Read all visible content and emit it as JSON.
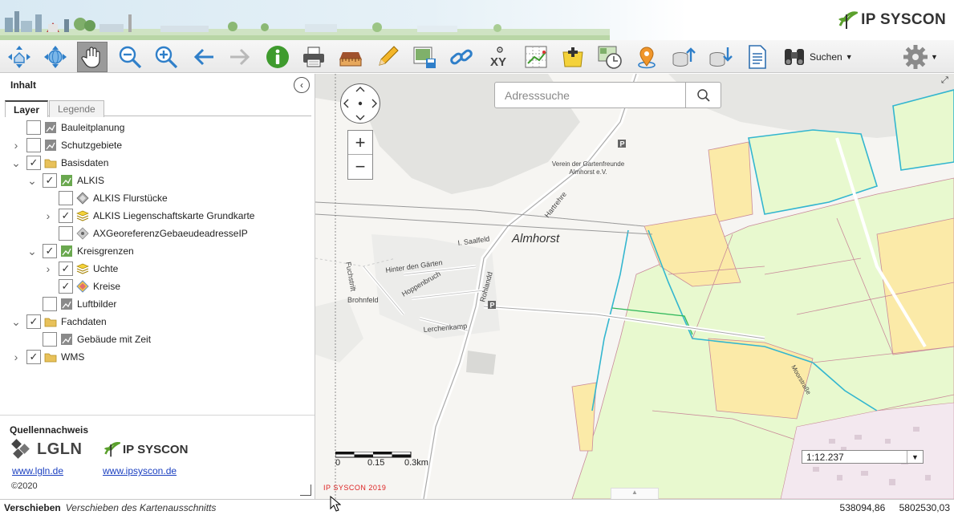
{
  "brand": {
    "name": "IP SYSCON"
  },
  "toolbar": {
    "tools": [
      {
        "name": "home-extent",
        "icon": "home-arrows-icon",
        "active": false
      },
      {
        "name": "globe-extent",
        "icon": "globe-icon",
        "active": false
      },
      {
        "name": "pan",
        "icon": "hand-icon",
        "active": true
      },
      {
        "name": "zoom-out",
        "icon": "zoom-out-icon",
        "active": false
      },
      {
        "name": "zoom-in",
        "icon": "zoom-in-icon",
        "active": false
      },
      {
        "name": "back",
        "icon": "arrow-left-icon",
        "active": false
      },
      {
        "name": "forward",
        "icon": "arrow-right-icon",
        "active": false
      },
      {
        "name": "info",
        "icon": "info-icon",
        "active": false
      },
      {
        "name": "print",
        "icon": "printer-icon",
        "active": false
      },
      {
        "name": "measure",
        "icon": "ruler-icon",
        "active": false
      },
      {
        "name": "draw",
        "icon": "pencil-icon",
        "active": false
      },
      {
        "name": "save-map",
        "icon": "save-image-icon",
        "active": false
      },
      {
        "name": "link",
        "icon": "link-icon",
        "active": false
      },
      {
        "name": "xy",
        "icon": "xy-icon",
        "active": false
      },
      {
        "name": "grid",
        "icon": "grid-icon",
        "active": false
      },
      {
        "name": "add-note",
        "icon": "sign-plus-icon",
        "active": false
      },
      {
        "name": "timeline",
        "icon": "clock-map-icon",
        "active": false
      },
      {
        "name": "location",
        "icon": "map-pin-icon",
        "active": false
      },
      {
        "name": "upload",
        "icon": "db-upload-icon",
        "active": false
      },
      {
        "name": "download",
        "icon": "db-download-icon",
        "active": false
      },
      {
        "name": "document",
        "icon": "document-icon",
        "active": false
      }
    ],
    "search_label": "Suchen",
    "search_icon": "binoculars-icon",
    "settings_icon": "gear-icon"
  },
  "panel": {
    "title": "Inhalt",
    "tabs": [
      {
        "label": "Layer",
        "active": true
      },
      {
        "label": "Legende",
        "active": false
      }
    ],
    "layers": [
      {
        "label": "Bauleitplanung",
        "level": 0,
        "expander": "",
        "checked": false,
        "icon": "raster-layer-icon"
      },
      {
        "label": "Schutzgebiete",
        "level": 0,
        "expander": ">",
        "checked": false,
        "icon": "raster-layer-icon"
      },
      {
        "label": "Basisdaten",
        "level": 0,
        "expander": "v",
        "checked": true,
        "icon": "folder-icon"
      },
      {
        "label": "ALKIS",
        "level": 1,
        "expander": "v",
        "checked": true,
        "icon": "raster-layer-green-icon"
      },
      {
        "label": "ALKIS Flurstücke",
        "level": 2,
        "expander": "",
        "checked": false,
        "icon": "vector-layer-icon"
      },
      {
        "label": "ALKIS Liegenschaftskarte Grundkarte",
        "level": 2,
        "expander": ">",
        "checked": true,
        "icon": "stack-layer-icon"
      },
      {
        "label": "AXGeoreferenzGebaeudeadresseIP",
        "level": 2,
        "expander": "",
        "checked": false,
        "icon": "point-layer-icon"
      },
      {
        "label": "Kreisgrenzen",
        "level": 1,
        "expander": "v",
        "checked": true,
        "icon": "raster-layer-green-icon"
      },
      {
        "label": "Uchte",
        "level": 2,
        "expander": ">",
        "checked": true,
        "icon": "stack-layer-icon"
      },
      {
        "label": "Kreise",
        "level": 2,
        "expander": "",
        "checked": true,
        "icon": "vector-layer-color-icon"
      },
      {
        "label": "Luftbilder",
        "level": 1,
        "expander": "",
        "checked": false,
        "icon": "raster-layer-icon"
      },
      {
        "label": "Fachdaten",
        "level": 0,
        "expander": "v",
        "checked": true,
        "icon": "folder-icon"
      },
      {
        "label": "Gebäude mit Zeit",
        "level": 1,
        "expander": "",
        "checked": false,
        "icon": "raster-layer-icon"
      },
      {
        "label": "WMS",
        "level": 0,
        "expander": ">",
        "checked": true,
        "icon": "folder-icon"
      }
    ],
    "credits": {
      "title": "Quellennachweis",
      "lgln_logo": "LGLN",
      "ipsyscon_logo": "IP SYSCON",
      "lgln_link": "www.lgln.de",
      "ipsyscon_link": "www.ipsyscon.de",
      "copyright": "©2020"
    }
  },
  "map": {
    "search_placeholder": "Adresssuche",
    "zoom_in": "+",
    "zoom_out": "−",
    "scale_value": "1:12.237",
    "scalebar_labels": [
      "0",
      "0.15",
      "0.3km"
    ],
    "copyright": "IP SYSCON 2019",
    "place_labels": {
      "town": "Almhorst",
      "club_line1": "Verein der Gartenfreunde",
      "club_line2": "Almhorst e.V.",
      "streets": [
        "Hartrehre",
        "I. Saalfeld",
        "Hinter den Gärten",
        "Hoppenbruch",
        "Fuchstrift",
        "Brohnfeld",
        "Rohlandd",
        "Lerchenkamp",
        "Moorstraße"
      ]
    }
  },
  "status": {
    "mode": "Verschieben",
    "hint": "Verschieben des Kartenausschnitts",
    "x": "538094,86",
    "y": "5802530,03"
  },
  "colors": {
    "accent_green": "#5aa02c",
    "field_yellow": "#fbeaa8",
    "field_green": "#e8f9cf",
    "parcel_blue": "#33b6cf",
    "parcel_line": "#c98a9a"
  }
}
